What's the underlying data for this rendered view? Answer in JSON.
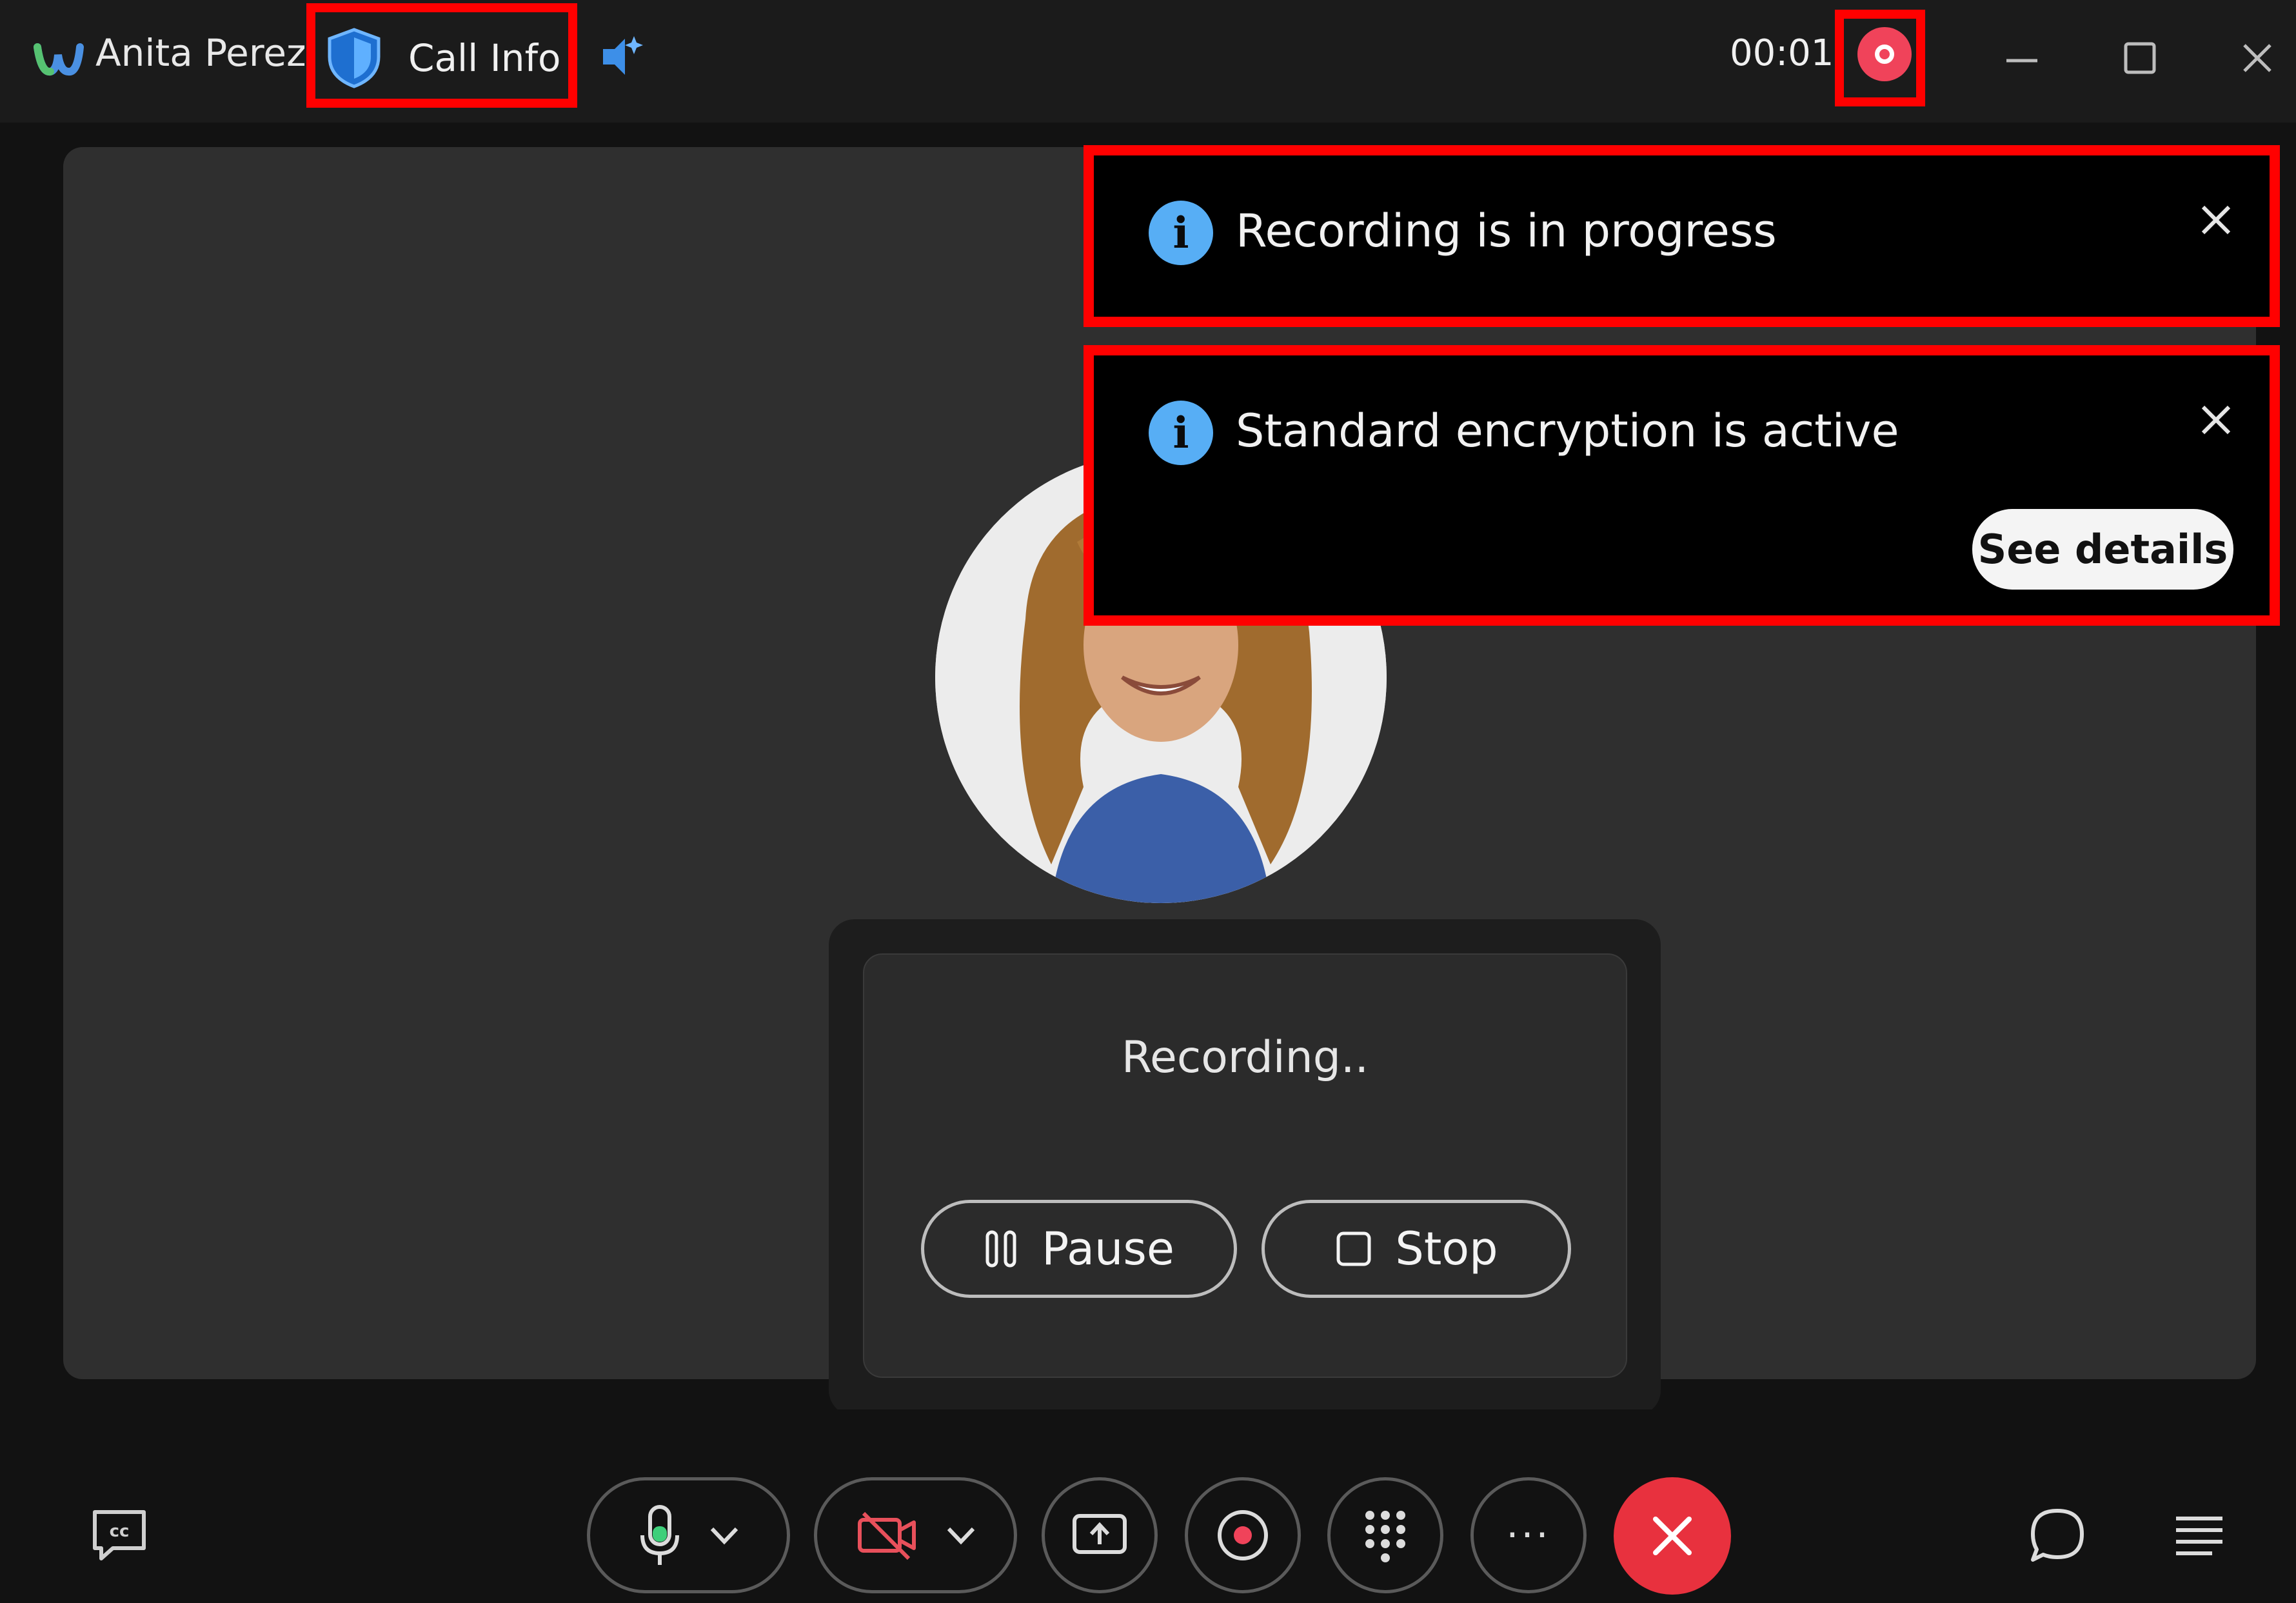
{
  "titlebar": {
    "caller_name": "Anita Perez",
    "call_info_label": "Call Info",
    "timer": "00:01"
  },
  "toasts": {
    "recording": {
      "text": "Recording is in progress"
    },
    "encryption": {
      "text": "Standard encryption is active",
      "action_label": "See details"
    }
  },
  "recording_popover": {
    "status": "Recording..",
    "pause_label": "Pause",
    "stop_label": "Stop"
  },
  "toolbar": {
    "more_label": "···"
  },
  "colors": {
    "accent_blue": "#57aef5",
    "record_red": "#f0435a",
    "end_call_red": "#e8313e",
    "highlight": "#ff0000"
  }
}
